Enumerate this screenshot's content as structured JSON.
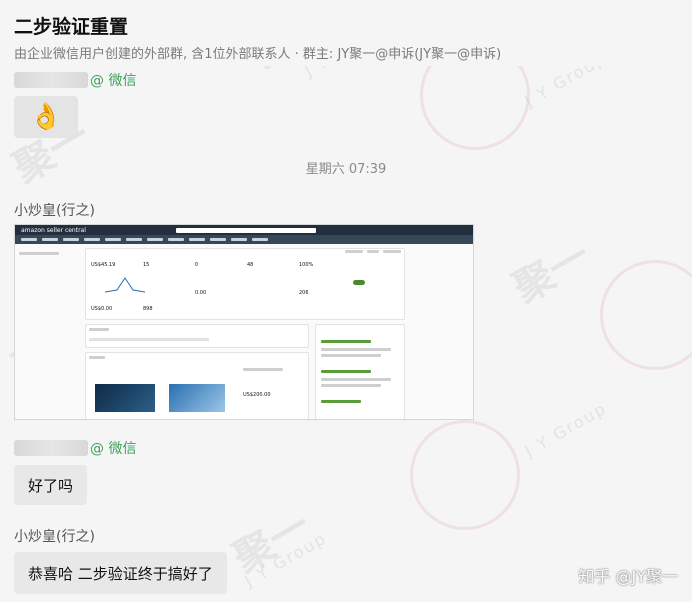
{
  "header": {
    "title": "二步验证重置",
    "subtitle": "由企业微信用户创建的外部群, 含1位外部联系人 · 群主: JY聚一@申诉(JY聚一@申诉)"
  },
  "messages": {
    "first_sender_tag": "@ 微信",
    "timestamp": "星期六 07:39",
    "sender_name_1": "小炒皇(行之)",
    "second_sender_tag": "@ 微信",
    "bubble_1": "好了吗",
    "sender_name_2": "小炒皇(行之)",
    "bubble_2": "恭喜哈 二步验证终于搞好了"
  },
  "screenshot": {
    "logo": "amazon seller central",
    "card_values": [
      "US$45.19",
      "15",
      "0",
      "48",
      "100%",
      "US$0.00",
      "898",
      "0.00",
      "206",
      "US$200.00"
    ]
  },
  "watermark": {
    "brand": "聚一",
    "group": "J Y Group",
    "footer": "知乎 @JY聚一"
  },
  "icons": {
    "emoji": "ok-hand-icon"
  }
}
